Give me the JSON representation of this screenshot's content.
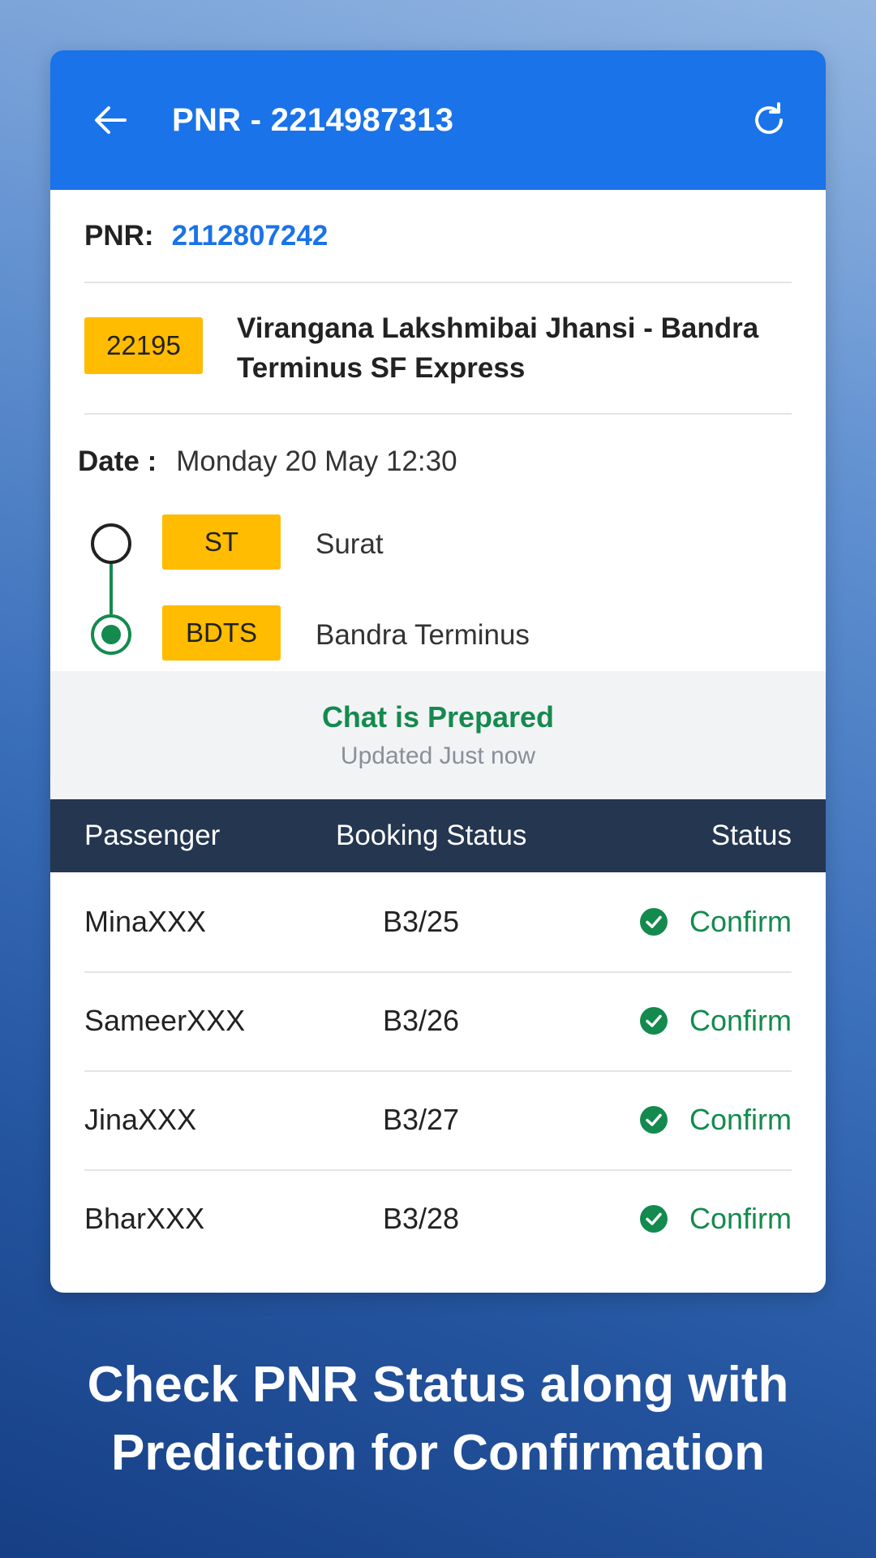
{
  "header": {
    "title": "PNR - 2214987313"
  },
  "pnr": {
    "label": "PNR:",
    "value": "2112807242"
  },
  "train": {
    "number": "22195",
    "name": "Virangana Lakshmibai Jhansi - Bandra Terminus SF Express"
  },
  "journey": {
    "date_label": "Date :",
    "date_value": "Monday 20 May 12:30",
    "from": {
      "code": "ST",
      "name": "Surat"
    },
    "to": {
      "code": "BDTS",
      "name": "Bandra Terminus"
    }
  },
  "chart": {
    "status": "Chat is Prepared",
    "updated": "Updated Just now"
  },
  "table": {
    "headers": [
      "Passenger",
      "Booking Status",
      "Status"
    ],
    "rows": [
      {
        "passenger": "MinaXXX",
        "booking": "B3/25",
        "status": "Confirm"
      },
      {
        "passenger": "SameerXXX",
        "booking": "B3/26",
        "status": "Confirm"
      },
      {
        "passenger": "JinaXXX",
        "booking": "B3/27",
        "status": "Confirm"
      },
      {
        "passenger": "BharXXX",
        "booking": "B3/28",
        "status": "Confirm"
      }
    ]
  },
  "tagline": {
    "line1": "Check PNR Status along with",
    "line2": "Prediction for Confirmation"
  },
  "colors": {
    "app_bar": "#1a73e8",
    "accent_yellow": "#ffbc00",
    "success_green": "#148a4e",
    "table_header": "#243650"
  },
  "icons": {
    "back": "arrow-left-icon",
    "refresh": "refresh-icon",
    "status": "check-circle-icon"
  }
}
